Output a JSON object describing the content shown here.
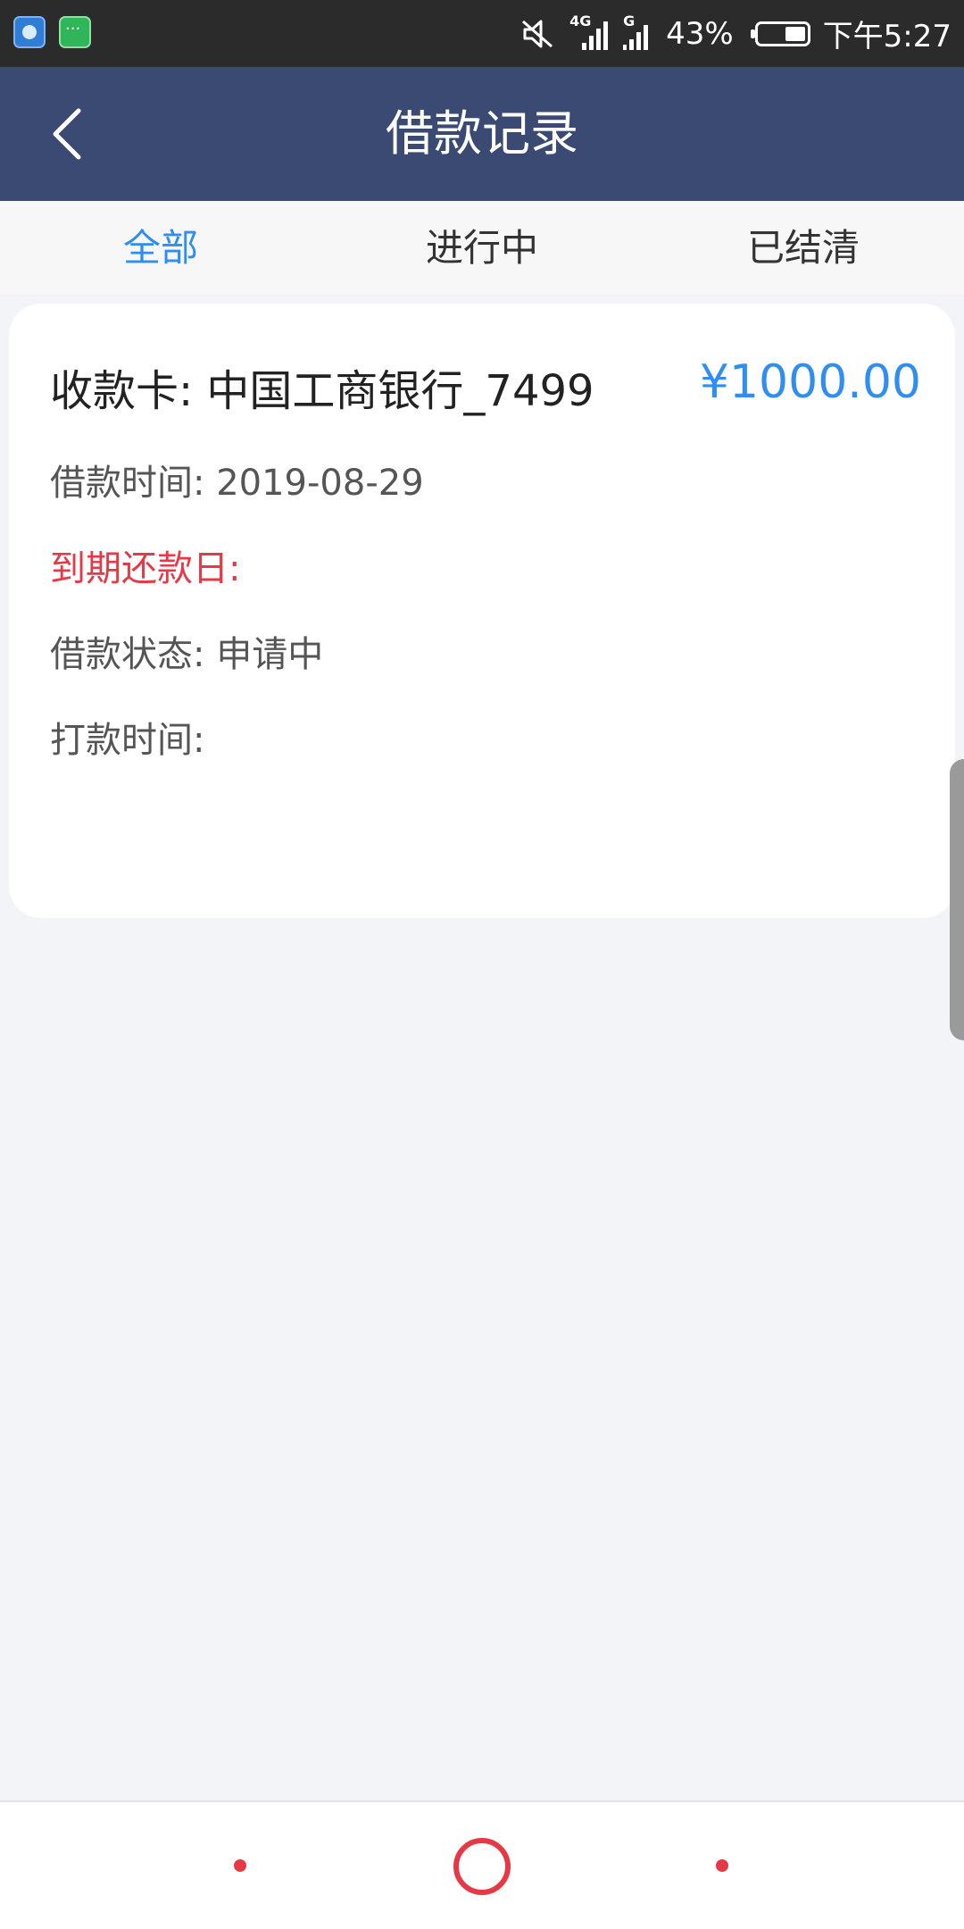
{
  "status_bar": {
    "app_icons": [
      "browser-icon",
      "chat-icon"
    ],
    "icons": [
      "mute-icon",
      "signal-4g-icon",
      "signal-g-icon",
      "battery-icon"
    ],
    "network_4g": "4G",
    "network_g": "G",
    "battery_percent": "43%",
    "battery_level": 0.43,
    "time": "下午5:27"
  },
  "header": {
    "back_icon": "chevron-left-icon",
    "title": "借款记录"
  },
  "tabs": [
    {
      "label": "全部",
      "active": true
    },
    {
      "label": "进行中",
      "active": false
    },
    {
      "label": "已结清",
      "active": false
    }
  ],
  "loan_record": {
    "card_label": "收款卡: 中国工商银行_7499",
    "amount": "¥1000.00",
    "loan_time": "借款时间: 2019-08-29",
    "due_date": "到期还款日:",
    "status": "借款状态: 申请中",
    "payment_time": "打款时间:"
  },
  "bottom_nav": {
    "items": [
      "nav-dot-left",
      "nav-home-circle",
      "nav-dot-right"
    ]
  },
  "colors": {
    "header_bg": "#3a4a72",
    "accent_blue": "#2f8ef0",
    "alert_red": "#e63946",
    "page_bg": "#f2f4f8",
    "status_bar_bg": "#2b2b2b"
  }
}
